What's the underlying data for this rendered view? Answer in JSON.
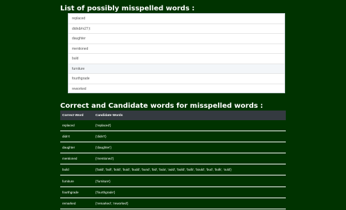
{
  "misspelled_section": {
    "title": "List of possibly misspelled words :",
    "items": [
      "replaced",
      "didn&#x27;t",
      "daughter",
      "mentioned",
      "buld",
      "furniture",
      "fourthgrade",
      "reworked"
    ]
  },
  "candidates_section": {
    "title": "Correct and Candidate words for misspelled words :",
    "columns": [
      "Correct Word",
      "Candidate Words"
    ],
    "rows": [
      {
        "correct": "replaced",
        "candidates": "{'replaced'}"
      },
      {
        "correct": "didn't",
        "candidates": "{'didn't'}"
      },
      {
        "correct": "daughter",
        "candidates": "{'daughter'}"
      },
      {
        "correct": "mentioned",
        "candidates": "{'mentioned'}"
      },
      {
        "correct": "build",
        "candidates": "{'bald', 'bull', 'bold', 'buid', 'budd', 'bund', 'bid', 'bula', 'auld', 'build', 'bulb', 'bould', 'bud', 'bulk', 'ould'}"
      },
      {
        "correct": "furniture",
        "candidates": "{'furniture'}"
      },
      {
        "correct": "fourthgrade",
        "candidates": "{'fourthgrade'}"
      },
      {
        "correct": "remarked",
        "candidates": "{'remarked', 'reworked'}"
      }
    ]
  },
  "colors": {
    "page_background": "#003300",
    "table_header_background": "#343a40",
    "list_background": "#ffffff"
  }
}
